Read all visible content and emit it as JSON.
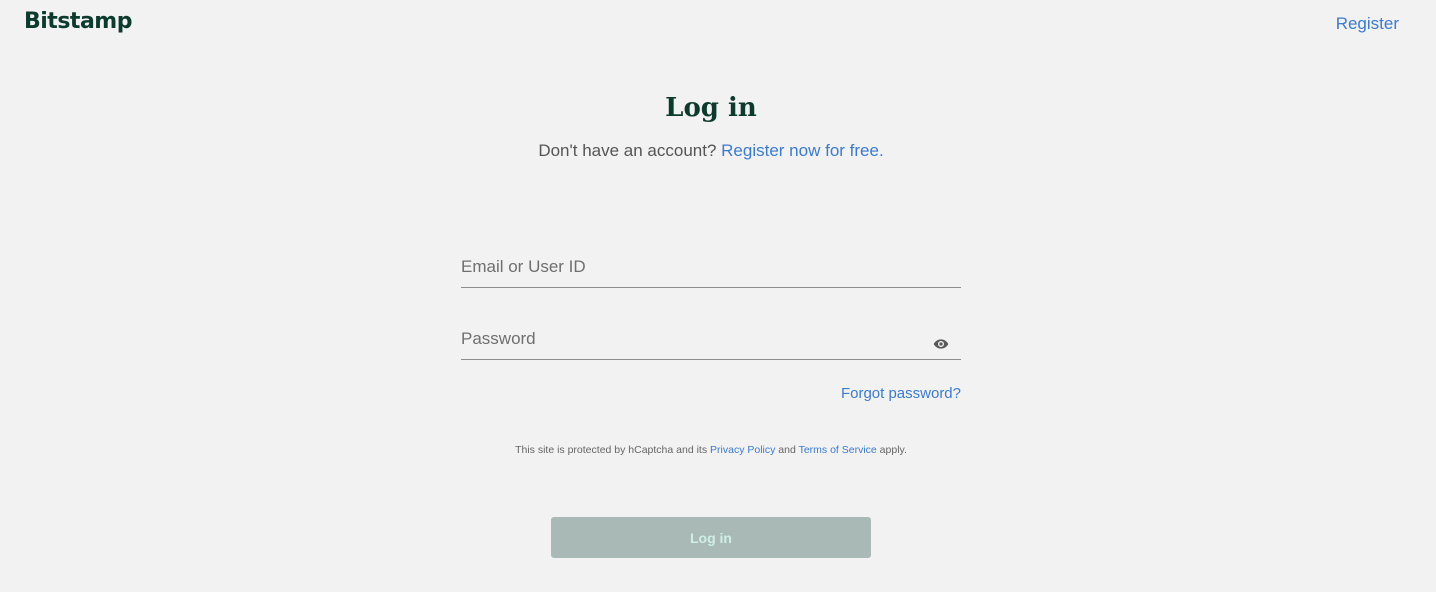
{
  "header": {
    "logo": "Bitstamp",
    "register_label": "Register"
  },
  "main": {
    "title": "Log in",
    "subtitle_text": "Don't have an account?",
    "subtitle_link": "Register now for free."
  },
  "form": {
    "email_placeholder": "Email or User ID",
    "password_placeholder": "Password",
    "forgot_label": "Forgot password?",
    "captcha": {
      "prefix": "This site is protected by hCaptcha and its",
      "privacy_link": "Privacy Policy",
      "and": "and",
      "terms_link": "Terms of Service",
      "suffix": "apply."
    },
    "login_button": "Log in"
  },
  "icons": {
    "password_toggle": "eye-icon"
  },
  "colors": {
    "brand": "#0c3b2e",
    "link": "#3b7bd0",
    "background": "#f2f2f2",
    "button_disabled_bg": "#a9bab6",
    "button_disabled_text": "#cfeee6"
  }
}
